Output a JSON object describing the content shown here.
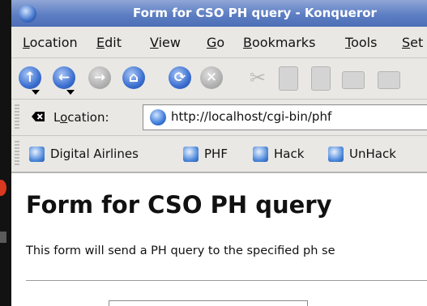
{
  "window": {
    "title": "Form for CSO PH query - Konqueror"
  },
  "menu": {
    "items": [
      {
        "pre": "",
        "key": "L",
        "rest": "ocation"
      },
      {
        "pre": "",
        "key": "E",
        "rest": "dit"
      },
      {
        "pre": "",
        "key": "V",
        "rest": "iew"
      },
      {
        "pre": "",
        "key": "G",
        "rest": "o"
      },
      {
        "pre": "",
        "key": "B",
        "rest": "ookmarks"
      },
      {
        "pre": "",
        "key": "T",
        "rest": "ools"
      },
      {
        "pre": "",
        "key": "S",
        "rest": "et"
      }
    ]
  },
  "toolbar": {
    "icons": [
      "up-icon",
      "back-icon",
      "forward-icon",
      "home-icon",
      "reload-icon",
      "stop-icon",
      "cut-icon",
      "copy-icon",
      "paste-icon",
      "print-icon"
    ]
  },
  "location": {
    "label_pre": "L",
    "label_key": "o",
    "label_rest": "cation:",
    "url": "http://localhost/cgi-bin/phf"
  },
  "bookmarks": [
    "Digital Airlines",
    "PHF",
    "Hack",
    "UnHack"
  ],
  "page": {
    "heading": "Form for CSO PH query",
    "intro": "This form will send a PH query to the specified ph se"
  }
}
